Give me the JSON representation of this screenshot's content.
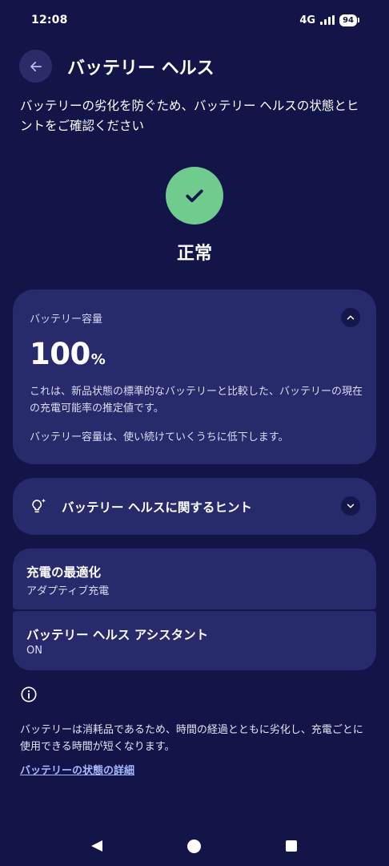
{
  "status_bar": {
    "time": "12:08",
    "network": "4G",
    "battery_level": "94"
  },
  "header": {
    "title": "バッテリー ヘルス",
    "back_icon": "arrow-back-icon"
  },
  "subtitle": "バッテリーの劣化を防ぐため、バッテリー ヘルスの状態とヒントをご確認ください",
  "status": {
    "text": "正常",
    "icon": "check-icon",
    "color": "#6fcb8e"
  },
  "capacity_card": {
    "label": "バッテリー容量",
    "value": "100",
    "unit": "%",
    "description": "これは、新品状態の標準的なバッテリーと比較した、バッテリーの現在の充電可能率の推定値です。",
    "note": "バッテリー容量は、使い続けていくうちに低下します。",
    "toggle_icon": "chevron-up-icon"
  },
  "tips_card": {
    "label": "バッテリー ヘルスに関するヒント",
    "icon": "lightbulb-sparkle-icon",
    "toggle_icon": "chevron-down-icon"
  },
  "settings": [
    {
      "title": "充電の最適化",
      "value": "アダプティブ充電"
    },
    {
      "title": "バッテリー ヘルス アシスタント",
      "value": "ON"
    }
  ],
  "footer": {
    "info_icon": "info-icon",
    "note": "バッテリーは消耗品であるため、時間の経過とともに劣化し、充電ごとに使用できる時間が短くなります。",
    "link": "バッテリーの状態の詳細"
  },
  "colors": {
    "background": "#131548",
    "card": "#272a6b",
    "link": "#a7b8ff"
  }
}
